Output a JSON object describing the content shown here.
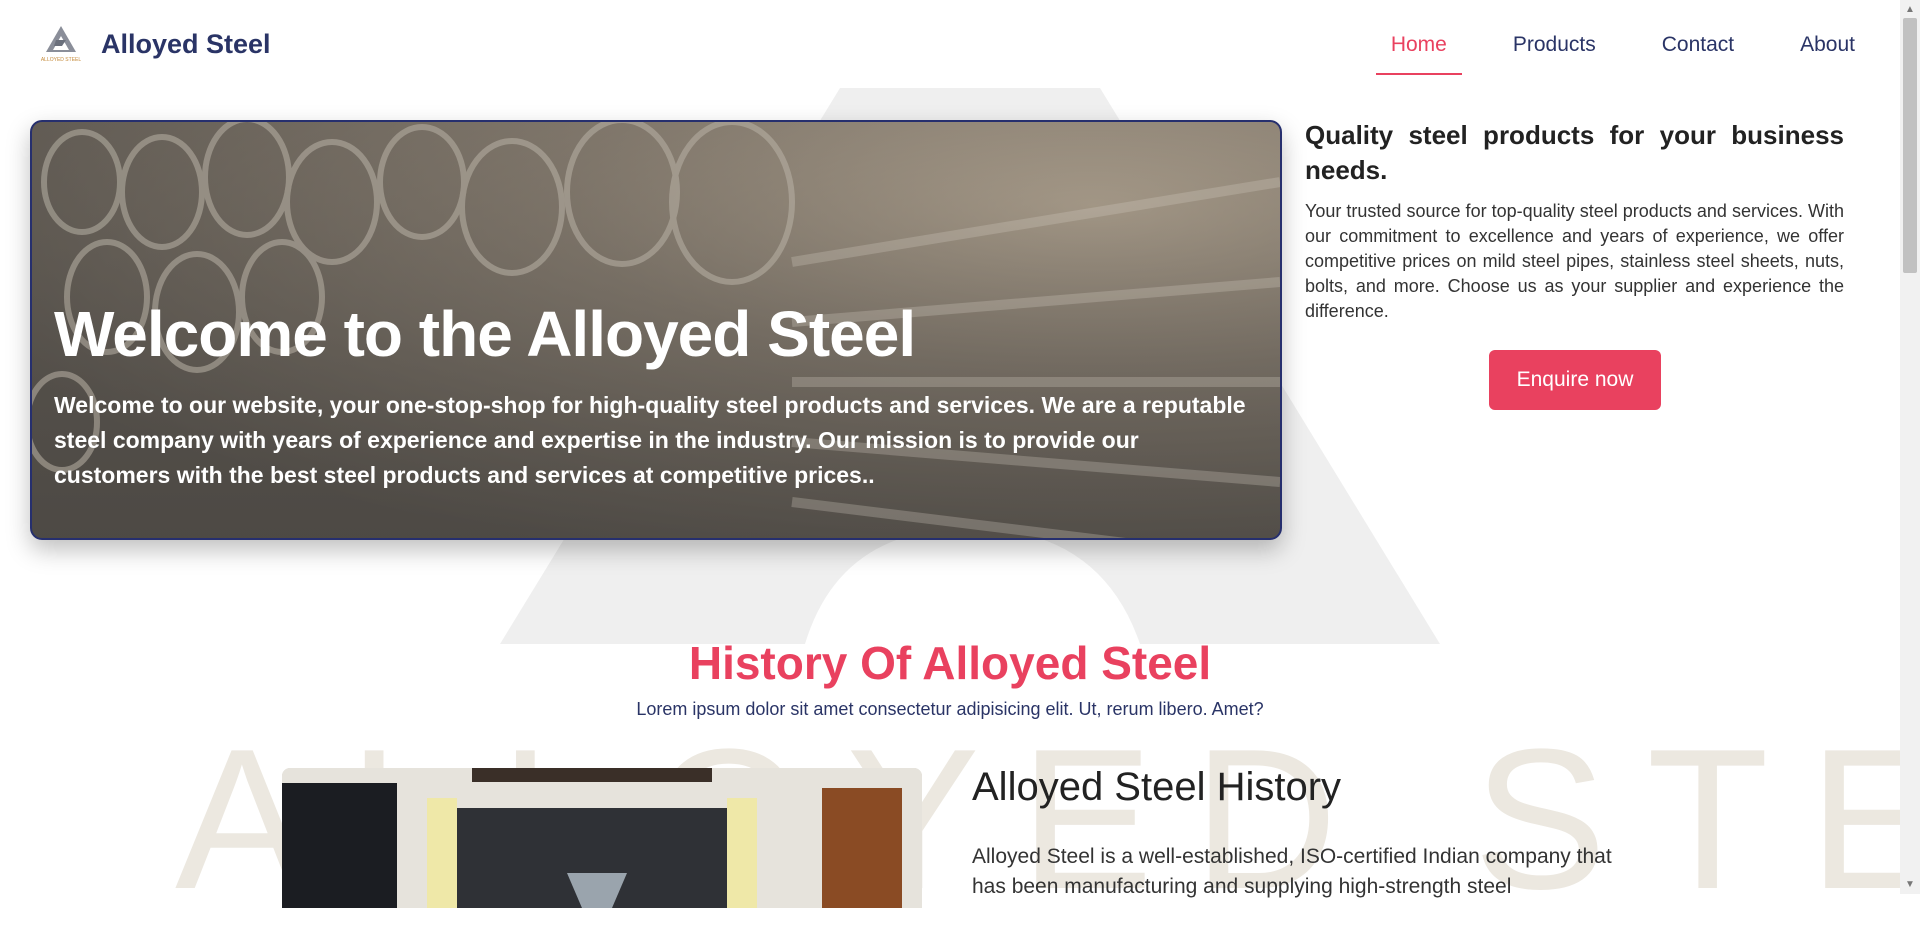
{
  "header": {
    "logo_text": "ALLOYED STEEL",
    "brand": "Alloyed Steel",
    "nav": [
      {
        "label": "Home",
        "active": true
      },
      {
        "label": "Products",
        "active": false
      },
      {
        "label": "Contact",
        "active": false
      },
      {
        "label": "About",
        "active": false
      }
    ]
  },
  "hero": {
    "title": "Welcome to the Alloyed Steel",
    "text": "Welcome to our website, your one-stop-shop for high-quality steel products and services. We are a reputable steel company with years of experience and expertise in the industry. Our mission is to provide our customers with the best steel products and services at competitive prices.."
  },
  "side": {
    "heading": "Quality steel products for your business needs.",
    "text": "Your trusted source for top-quality steel products and services. With our commitment to excellence and years of experience, we offer competitive prices on mild steel pipes, stainless steel sheets, nuts, bolts, and more. Choose us as your supplier and experience the difference.",
    "button": "Enquire now"
  },
  "history": {
    "title": "History Of Alloyed Steel",
    "subtitle": "Lorem ipsum dolor sit amet consectetur adipisicing elit. Ut, rerum libero. Amet?",
    "heading": "Alloyed Steel History",
    "paragraph": "Alloyed Steel is a well-established, ISO-certified Indian company that has been manufacturing and supplying high-strength steel"
  },
  "watermark": {
    "text": "ALLOYED STEEL"
  },
  "colors": {
    "accent": "#e9415f",
    "navy": "#2a3466"
  }
}
